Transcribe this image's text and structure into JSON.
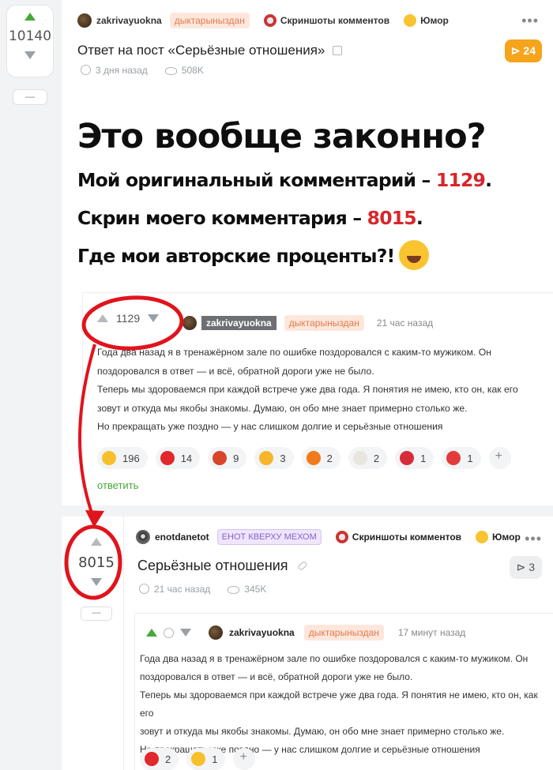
{
  "post": {
    "rating": "10140",
    "collapse_label": "—",
    "author": "zakrivayuokna",
    "author_tag": "дыктарыныздан",
    "categories": [
      "Скриншоты комментов",
      "Юмор"
    ],
    "title": "Ответ на пост «Серьёзные отношения»",
    "comments_count": "24",
    "time": "3 дня назад",
    "views": "508K"
  },
  "headline": {
    "line1": "Это вообще законно?",
    "line2_text": "Мой оригинальный комментарий – ",
    "line2_num": "1129",
    "line2_end": ".",
    "line3_text": "Скрин моего комментария – ",
    "line3_num": "8015",
    "line3_end": ".",
    "line4": "Где мои авторские проценты?!"
  },
  "comment": {
    "rating": "1129",
    "author": "zakrivayuokna",
    "author_tag": "дыктарыныздан",
    "time": "21 час назад",
    "lines": [
      "Года два назад я в тренажёрном зале по ошибке поздоровался с каким-то мужиком. Он",
      "поздоровался в ответ — и всё, обратной дороги уже не было.",
      "Теперь мы здороваемся при каждой встрече уже два года. Я понятия не имею, кто он, как его",
      "зовут и откуда мы якобы знакомы. Думаю, он обо мне знает примерно столько же.",
      "Но прекращать уже поздно — у нас слишком долгие и серьёзные отношения"
    ],
    "reactions": [
      {
        "icon": "laughing-emoji",
        "count": "196",
        "color": "#f7c02b"
      },
      {
        "icon": "heart-emoji",
        "count": "14",
        "color": "#e0282d"
      },
      {
        "icon": "accordion-emoji",
        "count": "9",
        "color": "#d8452b"
      },
      {
        "icon": "star-struck-emoji",
        "count": "3",
        "color": "#f7b52b"
      },
      {
        "icon": "fire-emoji",
        "count": "2",
        "color": "#f27a1a"
      },
      {
        "icon": "chicken-emoji",
        "count": "2",
        "color": "#e9e6e0"
      },
      {
        "icon": "strawberry-emoji",
        "count": "1",
        "color": "#d72d3a"
      },
      {
        "icon": "hundred-emoji",
        "count": "1",
        "color": "#e33b3b"
      }
    ],
    "reply_label": "ответить"
  },
  "original_post": {
    "rating": "8015",
    "collapse_label": "—",
    "author": "enotdanetot",
    "author_tag": "ЕНОТ КВЕРХУ МЕХОМ",
    "categories": [
      "Скриншоты комментов",
      "Юмор"
    ],
    "title": "Серьёзные отношения",
    "comments_count": "3",
    "time": "21 час назад",
    "views": "345K",
    "inner": {
      "author": "zakrivayuokna",
      "author_tag": "дыктарыныздан",
      "time": "17 минут назад",
      "lines": [
        "Года два назад я в тренажёрном зале по ошибке поздоровался с каким-то мужиком. Он",
        "поздоровался в ответ — и всё, обратной дороги уже не было.",
        "Теперь мы здороваемся при каждой встрече уже два года. Я понятия не имею, кто он, как его",
        "зовут и откуда мы якобы знакомы. Думаю, он обо мне знает примерно столько же.",
        "Но прекращать уже поздно — у нас слишком долгие и серьёзные отношения"
      ],
      "reactions": [
        {
          "icon": "heart-emoji",
          "count": "2",
          "color": "#e0282d"
        },
        {
          "icon": "laughing-emoji",
          "count": "1",
          "color": "#f7c02b"
        }
      ]
    }
  },
  "colors": {
    "accent_green": "#46a837",
    "badge_orange": "#f5a41c",
    "annotation_red": "#e0141c"
  }
}
